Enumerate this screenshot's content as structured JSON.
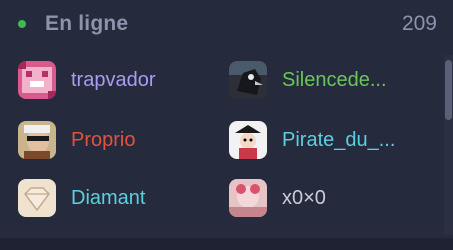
{
  "header": {
    "title": "En ligne",
    "count": "209",
    "status_color": "#3fb950"
  },
  "members": [
    {
      "name": "trapvador",
      "color": "#a99cf2",
      "avatar": "pink-pixel-avatar"
    },
    {
      "name": "Silencede...",
      "color": "#6ac65a",
      "avatar": "dark-bird-avatar"
    },
    {
      "name": "Proprio",
      "color": "#e2533f",
      "avatar": "sunglasses-man-avatar"
    },
    {
      "name": "Pirate_du_...",
      "color": "#5ad0e0",
      "avatar": "pirate-character-avatar"
    },
    {
      "name": "Diamant",
      "color": "#5ad0e0",
      "avatar": "diamond-avatar"
    },
    {
      "name": "x0×0",
      "color": "#c9ccd6",
      "avatar": "pink-cute-avatar"
    }
  ]
}
